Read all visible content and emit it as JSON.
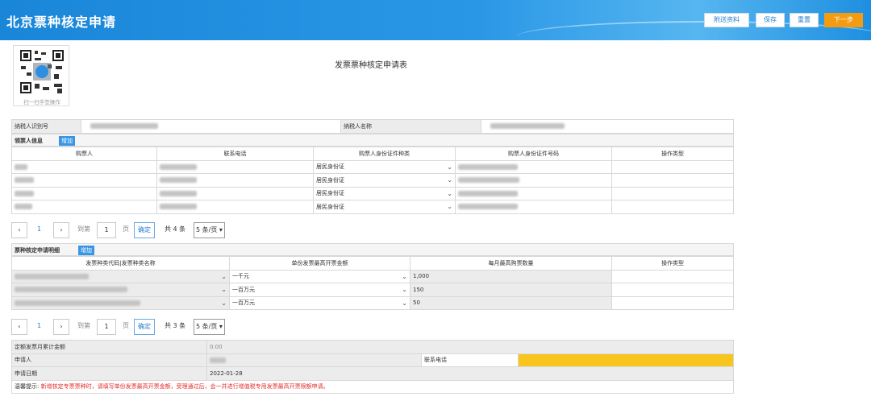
{
  "header": {
    "title": "北京票种核定申请",
    "buttons": {
      "attach": "附送资料",
      "save": "保存",
      "reset": "重置",
      "next": "下一步"
    }
  },
  "qr": {
    "caption": "扫一扫手签操作"
  },
  "doc_title": "发票票种核定申请表",
  "taxpayer": {
    "id_label": "纳税人识别号",
    "name_label": "纳税人名称"
  },
  "buyer_section": {
    "title": "领票人信息",
    "add": "增加",
    "columns": [
      "购票人",
      "联系电话",
      "购票人身份证件种类",
      "购票人身份证件号码",
      "操作类型"
    ],
    "rows": [
      {
        "id_type": "居民身份证"
      },
      {
        "id_type": "居民身份证"
      },
      {
        "id_type": "居民身份证"
      },
      {
        "id_type": "居民身份证"
      }
    ]
  },
  "pager1": {
    "page": "1",
    "goto_label": "到第",
    "goto_value": "1",
    "page_unit": "页",
    "confirm": "确定",
    "total": "共 4 条",
    "size": "5 条/页"
  },
  "ticket_section": {
    "title": "票种核定申请明细",
    "add": "增加",
    "columns": [
      "发票种类代码|发票种类名称",
      "单份发票最高开票金额",
      "每月最高购票数量",
      "操作类型"
    ],
    "rows": [
      {
        "max_amount": "一千元",
        "monthly_qty": "1,000"
      },
      {
        "max_amount": "一百万元",
        "monthly_qty": "150"
      },
      {
        "max_amount": "一百万元",
        "monthly_qty": "50"
      }
    ]
  },
  "pager2": {
    "page": "1",
    "goto_label": "到第",
    "goto_value": "1",
    "page_unit": "页",
    "confirm": "确定",
    "total": "共 3 条",
    "size": "5 条/页"
  },
  "summary": {
    "quota_label": "定额发票月累计金额",
    "quota_value": "0.00",
    "applicant_label": "申请人",
    "phone_label": "联系电话",
    "date_label": "申请日期",
    "date_value": "2022-01-28",
    "tip_label": "温馨提示:",
    "tip_text": "新增核定专票票种时，请填写单份发票最高开票金额，受理通过后，会一并进行增值税专用发票最高开票限额申请。"
  },
  "colors": {
    "header": "#1a86d8",
    "next_button": "#f39c12",
    "highlight_field": "#f8c51c",
    "warning_text": "#e52b2b"
  }
}
